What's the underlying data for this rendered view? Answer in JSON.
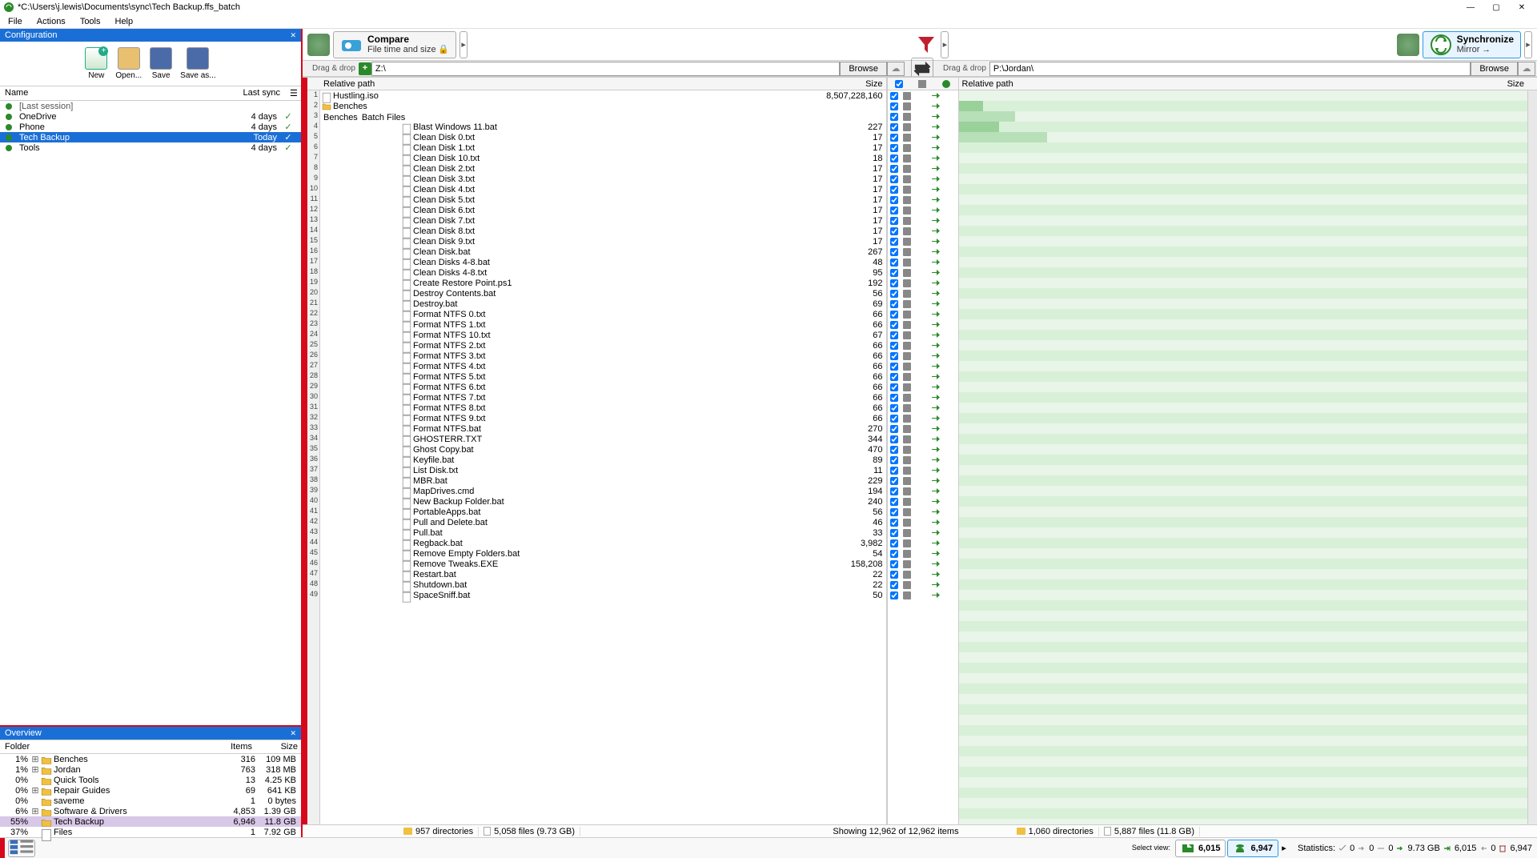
{
  "window": {
    "title": "*C:\\Users\\j.lewis\\Documents\\sync\\Tech Backup.ffs_batch"
  },
  "menu": {
    "file": "File",
    "actions": "Actions",
    "tools": "Tools",
    "help": "Help"
  },
  "config": {
    "header": "Configuration",
    "btn_new": "New",
    "btn_open": "Open...",
    "btn_save": "Save",
    "btn_saveas": "Save as...",
    "col_name": "Name",
    "col_sync": "Last sync",
    "rows": [
      {
        "name": "[Last session]",
        "sync": "",
        "session": true
      },
      {
        "name": "OneDrive",
        "sync": "4 days"
      },
      {
        "name": "Phone",
        "sync": "4 days"
      },
      {
        "name": "Tech Backup",
        "sync": "Today",
        "selected": true
      },
      {
        "name": "Tools",
        "sync": "4 days"
      }
    ]
  },
  "overview": {
    "header": "Overview",
    "col_folder": "Folder",
    "col_items": "Items",
    "col_size": "Size",
    "rows": [
      {
        "pct": "1%",
        "exp": true,
        "name": "Benches",
        "items": "316",
        "size": "109 MB"
      },
      {
        "pct": "1%",
        "exp": true,
        "name": "Jordan",
        "items": "763",
        "size": "318 MB"
      },
      {
        "pct": "0%",
        "exp": false,
        "name": "Quick Tools",
        "items": "13",
        "size": "4.25 KB"
      },
      {
        "pct": "0%",
        "exp": true,
        "name": "Repair Guides",
        "items": "69",
        "size": "641 KB"
      },
      {
        "pct": "0%",
        "exp": false,
        "name": "saveme",
        "items": "1",
        "size": "0 bytes"
      },
      {
        "pct": "6%",
        "exp": true,
        "name": "Software & Drivers",
        "items": "4,853",
        "size": "1.39 GB"
      },
      {
        "pct": "55%",
        "exp": false,
        "name": "Tech Backup",
        "items": "6,946",
        "size": "11.8 GB",
        "selected": true
      },
      {
        "pct": "37%",
        "exp": false,
        "name": "Files",
        "items": "1",
        "size": "7.92 GB",
        "isfile": true
      }
    ]
  },
  "compare": {
    "title": "Compare",
    "sub": "File time and size"
  },
  "sync": {
    "title": "Synchronize",
    "sub": "Mirror"
  },
  "paths": {
    "drag": "Drag & drop",
    "left": "Z:\\",
    "right": "P:\\Jordan\\",
    "browse": "Browse"
  },
  "grid": {
    "rel": "Relative path",
    "size": "Size"
  },
  "files": [
    {
      "indent": 0,
      "type": "file",
      "name": "Hustling.iso",
      "size": "8,507,228,160"
    },
    {
      "indent": 0,
      "type": "folder",
      "name": "Benches",
      "size": ""
    },
    {
      "indent": 0,
      "type": "crumb",
      "crumbs": [
        "Benches",
        "Batch Files"
      ],
      "size": ""
    },
    {
      "indent": 1,
      "type": "file",
      "name": "Blast Windows 11.bat",
      "size": "227"
    },
    {
      "indent": 1,
      "type": "file",
      "name": "Clean Disk 0.txt",
      "size": "17"
    },
    {
      "indent": 1,
      "type": "file",
      "name": "Clean Disk 1.txt",
      "size": "17"
    },
    {
      "indent": 1,
      "type": "file",
      "name": "Clean Disk 10.txt",
      "size": "18"
    },
    {
      "indent": 1,
      "type": "file",
      "name": "Clean Disk 2.txt",
      "size": "17"
    },
    {
      "indent": 1,
      "type": "file",
      "name": "Clean Disk 3.txt",
      "size": "17"
    },
    {
      "indent": 1,
      "type": "file",
      "name": "Clean Disk 4.txt",
      "size": "17"
    },
    {
      "indent": 1,
      "type": "file",
      "name": "Clean Disk 5.txt",
      "size": "17"
    },
    {
      "indent": 1,
      "type": "file",
      "name": "Clean Disk 6.txt",
      "size": "17"
    },
    {
      "indent": 1,
      "type": "file",
      "name": "Clean Disk 7.txt",
      "size": "17"
    },
    {
      "indent": 1,
      "type": "file",
      "name": "Clean Disk 8.txt",
      "size": "17"
    },
    {
      "indent": 1,
      "type": "file",
      "name": "Clean Disk 9.txt",
      "size": "17"
    },
    {
      "indent": 1,
      "type": "file",
      "name": "Clean Disk.bat",
      "size": "267"
    },
    {
      "indent": 1,
      "type": "file",
      "name": "Clean Disks 4-8.bat",
      "size": "48"
    },
    {
      "indent": 1,
      "type": "file",
      "name": "Clean Disks 4-8.txt",
      "size": "95"
    },
    {
      "indent": 1,
      "type": "file",
      "name": "Create Restore Point.ps1",
      "size": "192"
    },
    {
      "indent": 1,
      "type": "file",
      "name": "Destroy Contents.bat",
      "size": "56"
    },
    {
      "indent": 1,
      "type": "file",
      "name": "Destroy.bat",
      "size": "69"
    },
    {
      "indent": 1,
      "type": "file",
      "name": "Format NTFS 0.txt",
      "size": "66"
    },
    {
      "indent": 1,
      "type": "file",
      "name": "Format NTFS 1.txt",
      "size": "66"
    },
    {
      "indent": 1,
      "type": "file",
      "name": "Format NTFS 10.txt",
      "size": "67"
    },
    {
      "indent": 1,
      "type": "file",
      "name": "Format NTFS 2.txt",
      "size": "66"
    },
    {
      "indent": 1,
      "type": "file",
      "name": "Format NTFS 3.txt",
      "size": "66"
    },
    {
      "indent": 1,
      "type": "file",
      "name": "Format NTFS 4.txt",
      "size": "66"
    },
    {
      "indent": 1,
      "type": "file",
      "name": "Format NTFS 5.txt",
      "size": "66"
    },
    {
      "indent": 1,
      "type": "file",
      "name": "Format NTFS 6.txt",
      "size": "66"
    },
    {
      "indent": 1,
      "type": "file",
      "name": "Format NTFS 7.txt",
      "size": "66"
    },
    {
      "indent": 1,
      "type": "file",
      "name": "Format NTFS 8.txt",
      "size": "66"
    },
    {
      "indent": 1,
      "type": "file",
      "name": "Format NTFS 9.txt",
      "size": "66"
    },
    {
      "indent": 1,
      "type": "file",
      "name": "Format NTFS.bat",
      "size": "270"
    },
    {
      "indent": 1,
      "type": "file",
      "name": "GHOSTERR.TXT",
      "size": "344"
    },
    {
      "indent": 1,
      "type": "file",
      "name": "Ghost Copy.bat",
      "size": "470"
    },
    {
      "indent": 1,
      "type": "file",
      "name": "Keyfile.bat",
      "size": "89"
    },
    {
      "indent": 1,
      "type": "file",
      "name": "List Disk.txt",
      "size": "11"
    },
    {
      "indent": 1,
      "type": "file",
      "name": "MBR.bat",
      "size": "229"
    },
    {
      "indent": 1,
      "type": "file",
      "name": "MapDrives.cmd",
      "size": "194"
    },
    {
      "indent": 1,
      "type": "file",
      "name": "New Backup Folder.bat",
      "size": "240"
    },
    {
      "indent": 1,
      "type": "file",
      "name": "PortableApps.bat",
      "size": "56"
    },
    {
      "indent": 1,
      "type": "file",
      "name": "Pull and Delete.bat",
      "size": "46"
    },
    {
      "indent": 1,
      "type": "file",
      "name": "Pull.bat",
      "size": "33"
    },
    {
      "indent": 1,
      "type": "file",
      "name": "Regback.bat",
      "size": "3,982"
    },
    {
      "indent": 1,
      "type": "file",
      "name": "Remove Empty Folders.bat",
      "size": "54"
    },
    {
      "indent": 1,
      "type": "exe",
      "name": "Remove Tweaks.EXE",
      "size": "158,208"
    },
    {
      "indent": 1,
      "type": "file",
      "name": "Restart.bat",
      "size": "22"
    },
    {
      "indent": 1,
      "type": "file",
      "name": "Shutdown.bat",
      "size": "22"
    },
    {
      "indent": 1,
      "type": "file",
      "name": "SpaceSniff.bat",
      "size": "50"
    }
  ],
  "status": {
    "left_dirs": "957 directories",
    "left_files": "5,058 files (9.73 GB)",
    "showing": "Showing 12,962 of 12,962 items",
    "right_dirs": "1,060 directories",
    "right_files": "5,887 files (11.8 GB)"
  },
  "bottom": {
    "select_view": "Select view:",
    "count1": "6,015",
    "count2": "6,947",
    "statistics": "Statistics:",
    "s_vals": [
      "0",
      "0",
      "0",
      "9.73 GB",
      "6,015",
      "0",
      "6,947"
    ]
  }
}
